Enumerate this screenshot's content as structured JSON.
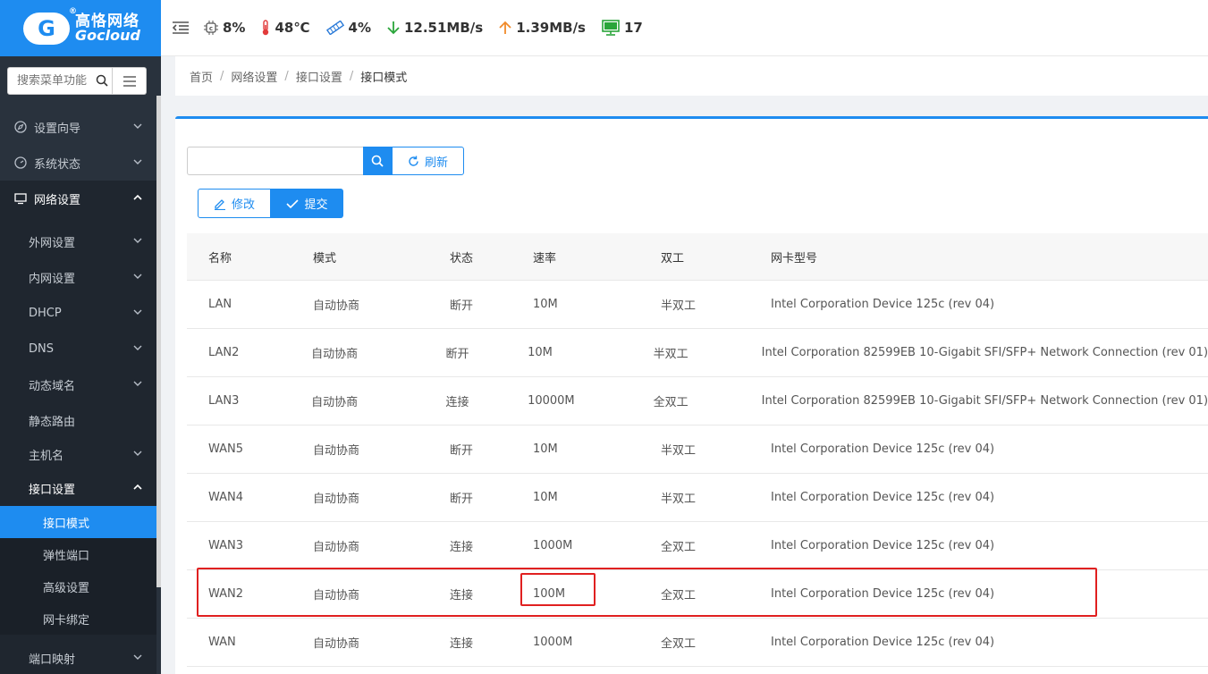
{
  "logo": {
    "cn": "高恪网络",
    "en": "Gocloud",
    "reg": "®",
    "mark": "G"
  },
  "topbar": {
    "cpu": "8%",
    "temp": "48℃",
    "mem": "4%",
    "download": "12.51MB/s",
    "upload": "1.39MB/s",
    "clients": "17"
  },
  "sidebar": {
    "search_placeholder": "搜索菜单功能",
    "items": [
      {
        "label": "设置向导"
      },
      {
        "label": "系统状态"
      },
      {
        "label": "网络设置"
      }
    ],
    "network_sub": [
      {
        "label": "外网设置"
      },
      {
        "label": "内网设置"
      },
      {
        "label": "DHCP"
      },
      {
        "label": "DNS"
      },
      {
        "label": "动态域名"
      },
      {
        "label": "静态路由"
      },
      {
        "label": "主机名"
      },
      {
        "label": "接口设置"
      }
    ],
    "interface_sub": [
      {
        "label": "接口模式"
      },
      {
        "label": "弹性端口"
      },
      {
        "label": "高级设置"
      },
      {
        "label": "网卡绑定"
      }
    ],
    "next": {
      "label": "端口映射"
    }
  },
  "breadcrumb": [
    "首页",
    "网络设置",
    "接口设置",
    "接口模式"
  ],
  "toolbar": {
    "refresh": "刷新",
    "edit": "修改",
    "submit": "提交"
  },
  "table": {
    "headers": [
      "名称",
      "模式",
      "状态",
      "速率",
      "双工",
      "网卡型号"
    ],
    "rows": [
      [
        "LAN",
        "自动协商",
        "断开",
        "10M",
        "半双工",
        "Intel Corporation Device 125c (rev 04)"
      ],
      [
        "LAN2",
        "自动协商",
        "断开",
        "10M",
        "半双工",
        "Intel Corporation 82599EB 10-Gigabit SFI/SFP+ Network Connection (rev 01)"
      ],
      [
        "LAN3",
        "自动协商",
        "连接",
        "10000M",
        "全双工",
        "Intel Corporation 82599EB 10-Gigabit SFI/SFP+ Network Connection (rev 01)"
      ],
      [
        "WAN5",
        "自动协商",
        "断开",
        "10M",
        "半双工",
        "Intel Corporation Device 125c (rev 04)"
      ],
      [
        "WAN4",
        "自动协商",
        "断开",
        "10M",
        "半双工",
        "Intel Corporation Device 125c (rev 04)"
      ],
      [
        "WAN3",
        "自动协商",
        "连接",
        "1000M",
        "全双工",
        "Intel Corporation Device 125c (rev 04)"
      ],
      [
        "WAN2",
        "自动协商",
        "连接",
        "100M",
        "全双工",
        "Intel Corporation Device 125c (rev 04)"
      ],
      [
        "WAN",
        "自动协商",
        "连接",
        "1000M",
        "全双工",
        "Intel Corporation Device 125c (rev 04)"
      ]
    ]
  },
  "colors": {
    "accent": "#1e8cf0",
    "sidebar": "#29323d",
    "highlight": "#e02020"
  }
}
